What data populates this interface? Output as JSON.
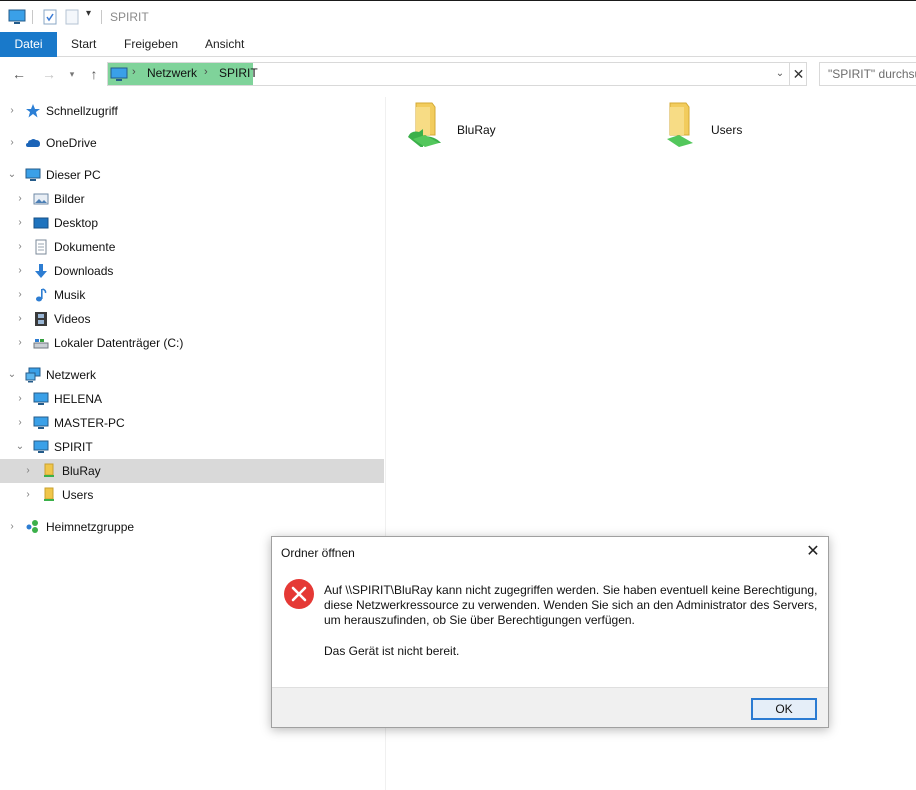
{
  "window": {
    "title": "SPIRIT"
  },
  "ribbon": {
    "tabs": [
      "Datei",
      "Start",
      "Freigeben",
      "Ansicht"
    ]
  },
  "address": {
    "segments": [
      "Netzwerk",
      "SPIRIT"
    ],
    "search_placeholder": "\"SPIRIT\" durchsuchen"
  },
  "nav_pane": {
    "items": [
      {
        "label": "Schnellzugriff",
        "icon": "star-icon"
      },
      {
        "label": "OneDrive",
        "icon": "cloud-icon"
      },
      {
        "label": "Dieser PC",
        "icon": "computer-icon"
      },
      {
        "label": "Bilder",
        "icon": "pictures-icon"
      },
      {
        "label": "Desktop",
        "icon": "desktop-icon"
      },
      {
        "label": "Dokumente",
        "icon": "documents-icon"
      },
      {
        "label": "Downloads",
        "icon": "download-arrow-icon"
      },
      {
        "label": "Musik",
        "icon": "music-note-icon"
      },
      {
        "label": "Videos",
        "icon": "film-icon"
      },
      {
        "label": "Lokaler Datenträger (C:)",
        "icon": "drive-icon"
      },
      {
        "label": "Netzwerk",
        "icon": "network-icon"
      },
      {
        "label": "HELENA",
        "icon": "computer-icon"
      },
      {
        "label": "MASTER-PC",
        "icon": "computer-icon"
      },
      {
        "label": "SPIRIT",
        "icon": "computer-icon"
      },
      {
        "label": "BluRay",
        "icon": "shared-folder-icon"
      },
      {
        "label": "Users",
        "icon": "shared-folder-icon"
      },
      {
        "label": "Heimnetzgruppe",
        "icon": "homegroup-icon"
      }
    ]
  },
  "content": {
    "items": [
      {
        "label": "BluRay"
      },
      {
        "label": "Users"
      }
    ]
  },
  "dialog": {
    "title": "Ordner öffnen",
    "message": "Auf \\\\SPIRIT\\BluRay kann nicht zugegriffen werden. Sie haben eventuell keine Berechtigung, diese Netzwerkressource zu verwenden. Wenden Sie sich an den Administrator des Servers, um herauszufinden, ob Sie über Berechtigungen verfügen.",
    "detail": "Das Gerät ist nicht bereit.",
    "ok_label": "OK",
    "close_glyph": "✕"
  },
  "colors": {
    "accent": "#1979ca",
    "selection": "#d9d9d9",
    "address_highlight": "#7fd39a",
    "error_red": "#e53935"
  }
}
